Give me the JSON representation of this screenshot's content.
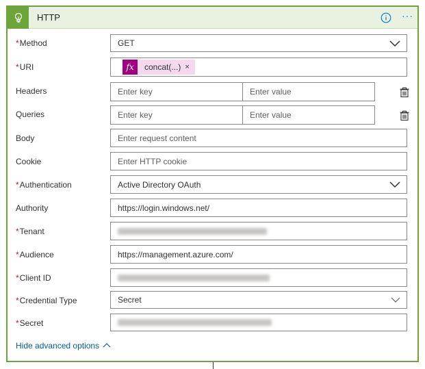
{
  "header": {
    "title": "HTTP",
    "more_label": "···"
  },
  "colors": {
    "accent": "#6ea539",
    "header_bg": "#e9f2e0",
    "link": "#005a9e",
    "function_token": "#a1007f",
    "required": "#a4262c"
  },
  "fields": {
    "method": {
      "label": "Method",
      "required": "*",
      "value": "GET"
    },
    "uri": {
      "label": "URI",
      "required": "*",
      "token_icon": "fx",
      "token_label": "concat(...)",
      "token_remove": "×"
    },
    "headers": {
      "label": "Headers",
      "key_placeholder": "Enter key",
      "value_placeholder": "Enter value"
    },
    "queries": {
      "label": "Queries",
      "key_placeholder": "Enter key",
      "value_placeholder": "Enter value"
    },
    "body": {
      "label": "Body",
      "placeholder": "Enter request content"
    },
    "cookie": {
      "label": "Cookie",
      "placeholder": "Enter HTTP cookie"
    },
    "authentication": {
      "label": "Authentication",
      "required": "*",
      "value": "Active Directory OAuth"
    },
    "authority": {
      "label": "Authority",
      "value": "https://login.windows.net/"
    },
    "tenant": {
      "label": "Tenant",
      "required": "*"
    },
    "audience": {
      "label": "Audience",
      "required": "*",
      "value": "https://management.azure.com/"
    },
    "client_id": {
      "label": "Client ID",
      "required": "*"
    },
    "credential_type": {
      "label": "Credential Type",
      "required": "*",
      "value": "Secret"
    },
    "secret": {
      "label": "Secret",
      "required": "*"
    }
  },
  "advanced_link": "Hide advanced options",
  "icons": {
    "header": "bulb-icon",
    "info": "info-icon",
    "more": "ellipsis-icon",
    "delete": "trash-icon",
    "dropdown": "chevron-down-icon",
    "collapse": "chevron-up-icon"
  }
}
